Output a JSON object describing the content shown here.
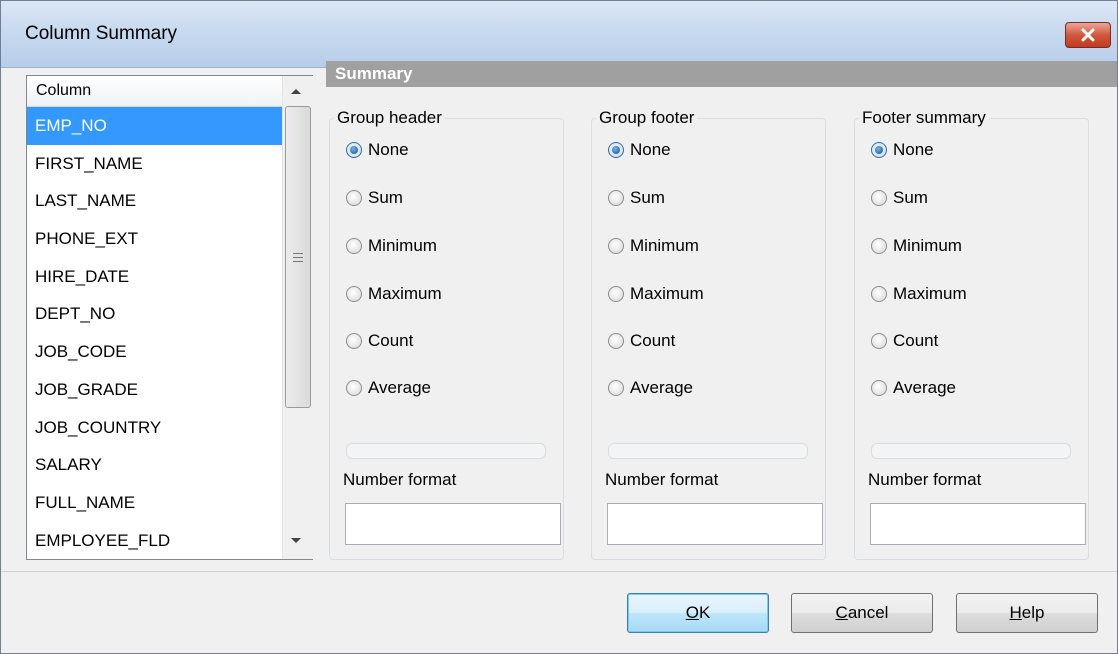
{
  "window": {
    "title": "Column Summary"
  },
  "column_list": {
    "header": "Column",
    "items": [
      "EMP_NO",
      "FIRST_NAME",
      "LAST_NAME",
      "PHONE_EXT",
      "HIRE_DATE",
      "DEPT_NO",
      "JOB_CODE",
      "JOB_GRADE",
      "JOB_COUNTRY",
      "SALARY",
      "FULL_NAME",
      "EMPLOYEE_FLD"
    ],
    "selected": "EMP_NO"
  },
  "summary": {
    "title": "Summary",
    "groups": [
      {
        "title": "Group header",
        "options": [
          "None",
          "Sum",
          "Minimum",
          "Maximum",
          "Count",
          "Average"
        ],
        "selected": "None",
        "number_format_label": "Number format",
        "number_format_value": ""
      },
      {
        "title": "Group footer",
        "options": [
          "None",
          "Sum",
          "Minimum",
          "Maximum",
          "Count",
          "Average"
        ],
        "selected": "None",
        "number_format_label": "Number format",
        "number_format_value": ""
      },
      {
        "title": "Footer summary",
        "options": [
          "None",
          "Sum",
          "Minimum",
          "Maximum",
          "Count",
          "Average"
        ],
        "selected": "None",
        "number_format_label": "Number format",
        "number_format_value": ""
      }
    ]
  },
  "buttons": {
    "ok": {
      "accel": "O",
      "rest": "K"
    },
    "cancel": {
      "accel": "C",
      "rest": "ancel"
    },
    "help": {
      "accel": "H",
      "rest": "elp"
    }
  },
  "icons": {
    "close": "close-icon",
    "grip": "scrollbar-grip-icon",
    "up": "scroll-up-icon",
    "down": "scroll-down-icon"
  }
}
